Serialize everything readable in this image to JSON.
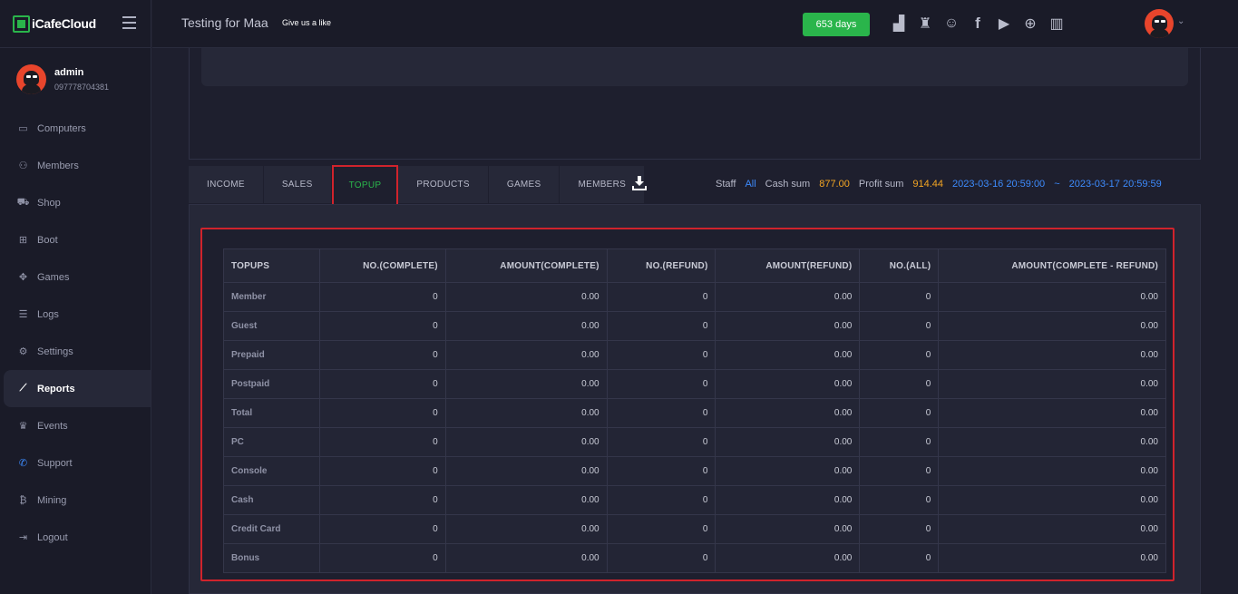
{
  "brand": {
    "name": "iCafeCloud"
  },
  "user": {
    "name": "admin",
    "phone": "097778704381"
  },
  "nav": [
    {
      "label": "Computers",
      "icon": "monitor-icon"
    },
    {
      "label": "Members",
      "icon": "users-icon"
    },
    {
      "label": "Shop",
      "icon": "cart-icon"
    },
    {
      "label": "Boot",
      "icon": "windows-icon"
    },
    {
      "label": "Games",
      "icon": "gamepad-icon"
    },
    {
      "label": "Logs",
      "icon": "list-icon"
    },
    {
      "label": "Settings",
      "icon": "gear-icon"
    },
    {
      "label": "Reports",
      "icon": "chart-line-icon"
    },
    {
      "label": "Events",
      "icon": "crown-icon"
    },
    {
      "label": "Support",
      "icon": "phone-icon"
    },
    {
      "label": "Mining",
      "icon": "bitcoin-icon"
    },
    {
      "label": "Logout",
      "icon": "logout-icon"
    }
  ],
  "header": {
    "cafe_name": "Testing for Maa",
    "like_link": "Give us a like",
    "days": "653 days",
    "icons": [
      "leaderboard-icon",
      "trophy-icon",
      "discord-icon",
      "facebook-icon",
      "youtube-icon",
      "globe-icon",
      "book-icon"
    ]
  },
  "tabs": [
    "INCOME",
    "SALES",
    "TOPUP",
    "PRODUCTS",
    "GAMES",
    "MEMBERS"
  ],
  "active_tab": "TOPUP",
  "summary": {
    "staff_label": "Staff",
    "staff_value": "All",
    "cash_label": "Cash sum",
    "cash_value": "877.00",
    "profit_label": "Profit sum",
    "profit_value": "914.44",
    "date_from": "2023-03-16 20:59:00",
    "date_sep": "~",
    "date_to": "2023-03-17 20:59:59"
  },
  "table": {
    "headers": [
      "TOPUPS",
      "NO.(COMPLETE)",
      "AMOUNT(COMPLETE)",
      "NO.(REFUND)",
      "AMOUNT(REFUND)",
      "NO.(ALL)",
      "AMOUNT(COMPLETE - REFUND)"
    ],
    "rows": [
      [
        "Member",
        "0",
        "0.00",
        "0",
        "0.00",
        "0",
        "0.00"
      ],
      [
        "Guest",
        "0",
        "0.00",
        "0",
        "0.00",
        "0",
        "0.00"
      ],
      [
        "Prepaid",
        "0",
        "0.00",
        "0",
        "0.00",
        "0",
        "0.00"
      ],
      [
        "Postpaid",
        "0",
        "0.00",
        "0",
        "0.00",
        "0",
        "0.00"
      ],
      [
        "Total",
        "0",
        "0.00",
        "0",
        "0.00",
        "0",
        "0.00"
      ],
      [
        "PC",
        "0",
        "0.00",
        "0",
        "0.00",
        "0",
        "0.00"
      ],
      [
        "Console",
        "0",
        "0.00",
        "0",
        "0.00",
        "0",
        "0.00"
      ],
      [
        "Cash",
        "0",
        "0.00",
        "0",
        "0.00",
        "0",
        "0.00"
      ],
      [
        "Credit Card",
        "0",
        "0.00",
        "0",
        "0.00",
        "0",
        "0.00"
      ],
      [
        "Bonus",
        "0",
        "0.00",
        "0",
        "0.00",
        "0",
        "0.00"
      ]
    ]
  },
  "colors": {
    "accent_green": "#2ab54b",
    "highlight_red": "#d0232c",
    "link_blue": "#3d8bfd",
    "value_orange": "#f4a623"
  }
}
